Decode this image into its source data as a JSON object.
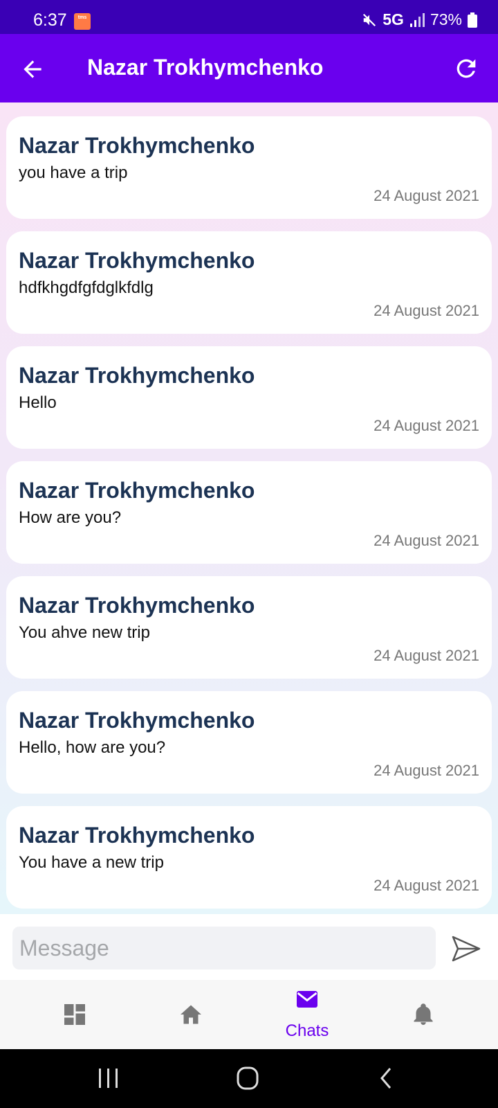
{
  "status_bar": {
    "time": "6:37",
    "notification_icon_text": "tms",
    "network": "5G",
    "battery": "73%"
  },
  "app_bar": {
    "title": "Nazar Trokhymchenko",
    "back_icon": "arrow-back-icon",
    "refresh_icon": "refresh-icon"
  },
  "messages": [
    {
      "sender": "Nazar Trokhymchenko",
      "text": "you have a trip",
      "date": "24 August 2021"
    },
    {
      "sender": "Nazar Trokhymchenko",
      "text": "hdfkhgdfgfdglkfdlg",
      "date": "24 August 2021"
    },
    {
      "sender": "Nazar Trokhymchenko",
      "text": "Hello",
      "date": "24 August 2021"
    },
    {
      "sender": "Nazar Trokhymchenko",
      "text": "How are you?",
      "date": "24 August 2021"
    },
    {
      "sender": "Nazar Trokhymchenko",
      "text": "You ahve new trip",
      "date": "24 August 2021"
    },
    {
      "sender": "Nazar Trokhymchenko",
      "text": "Hello, how are you?",
      "date": "24 August 2021"
    },
    {
      "sender": "Nazar Trokhymchenko",
      "text": "You have a new trip",
      "date": "24 August 2021"
    }
  ],
  "composer": {
    "placeholder": "Message",
    "value": "",
    "send_icon": "send-icon"
  },
  "bottom_nav": {
    "items": [
      {
        "icon": "dashboard-icon",
        "label": "",
        "active": false
      },
      {
        "icon": "home-icon",
        "label": "",
        "active": false
      },
      {
        "icon": "mail-icon",
        "label": "Chats",
        "active": true
      },
      {
        "icon": "bell-icon",
        "label": "",
        "active": false
      }
    ]
  },
  "colors": {
    "status_bar": "#3a00b5",
    "app_bar": "#6a00ee",
    "accent": "#6a00ee",
    "sender_name": "#1c3354",
    "date_text": "#777777",
    "inactive_nav_icon": "#777777"
  }
}
